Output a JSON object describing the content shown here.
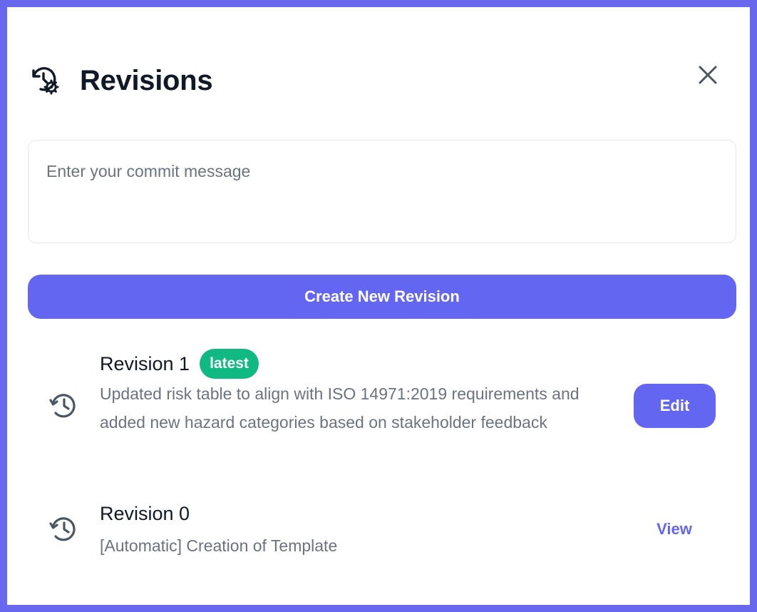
{
  "header": {
    "title": "Revisions",
    "icon": "history-settings-icon",
    "close_icon": "close-icon"
  },
  "commit_input": {
    "placeholder": "Enter your commit message",
    "value": ""
  },
  "create_button": {
    "label": "Create New Revision"
  },
  "revisions": [
    {
      "title": "Revision 1",
      "badge": "latest",
      "description": "Updated risk table to align with ISO 14971:2019 requirements and added new hazard categories based on stakeholder feedback",
      "action": "Edit",
      "icon": "history-icon"
    },
    {
      "title": "Revision 0",
      "description": "[Automatic] Creation of Template",
      "action": "View",
      "icon": "history-icon"
    }
  ],
  "colors": {
    "accent": "#6366f1",
    "badge": "#10b981",
    "frame": "#6868ee",
    "text_primary": "#111827",
    "text_muted": "#6b7280"
  }
}
